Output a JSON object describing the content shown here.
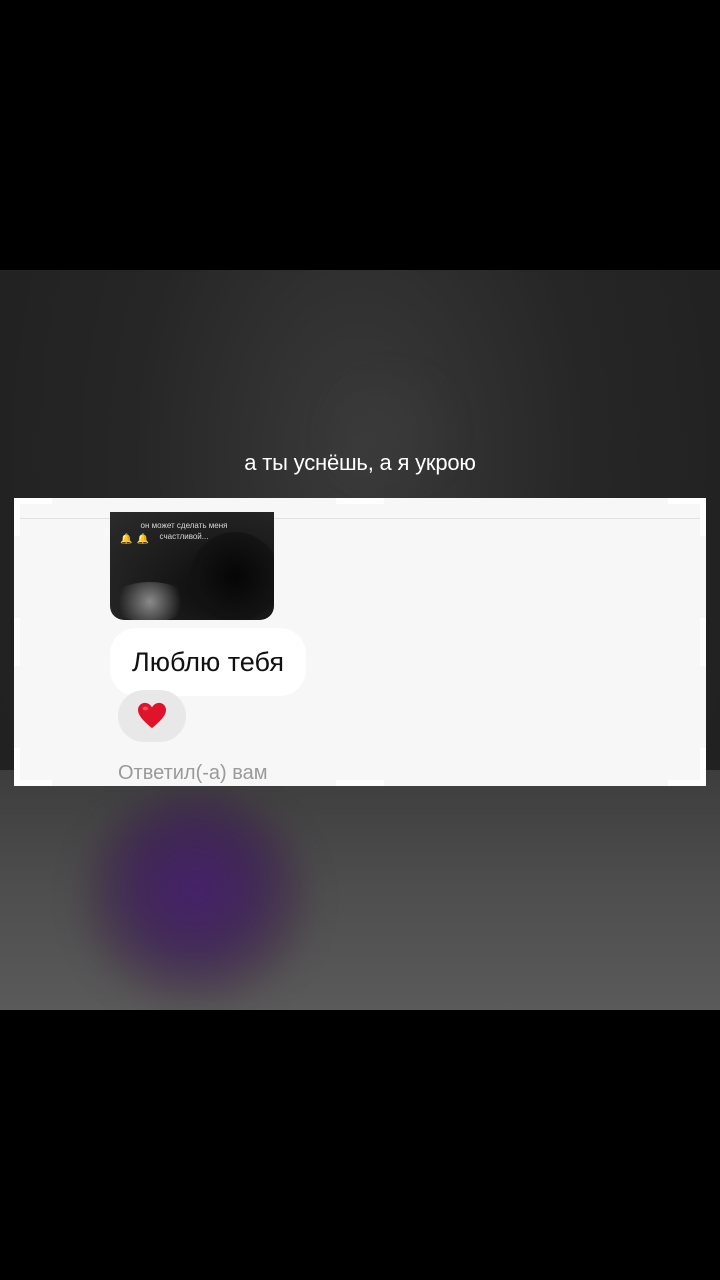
{
  "caption": {
    "text": "а ты уснёшь, а я укрою"
  },
  "chat": {
    "story_preview": {
      "text": "он может сделать меня счастливой...",
      "bells": "🔔🔔"
    },
    "message": {
      "text": "Люблю тебя"
    },
    "reaction": {
      "icon": "heart-icon",
      "color": "#e0132b"
    },
    "replied_label": "Ответил(-а) вам"
  },
  "colors": {
    "background": "#000000",
    "card": "#f7f7f7",
    "bubble": "#ffffff",
    "reaction_pill": "#e8e8e8"
  }
}
